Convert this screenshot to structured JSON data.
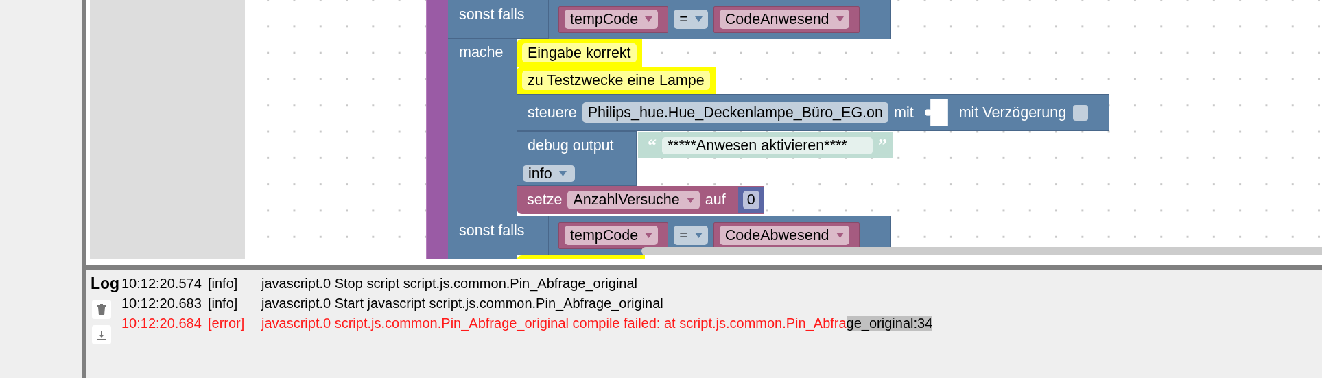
{
  "workspace": {
    "blocks": [
      {
        "kind": "else_if",
        "label": "sonst falls",
        "left_variable": "tempCode",
        "operator": "=",
        "right_variable": "CodeAnwesend"
      },
      {
        "kind": "do",
        "label": "mache"
      },
      {
        "kind": "comment",
        "text": "Eingabe korrekt"
      },
      {
        "kind": "comment",
        "text": "zu Testzwecke eine Lampe"
      },
      {
        "kind": "control",
        "label": "steuere",
        "object": "Philips_hue.Hue_Deckenlampe_Büro_EG.on",
        "with_label": "mit",
        "delay_label": "mit Verzögerung"
      },
      {
        "kind": "debug",
        "label": "debug output",
        "open_quote": "“",
        "text": "*****Anwesen aktivieren****",
        "close_quote": "”",
        "severity": "info"
      },
      {
        "kind": "set",
        "label": "setze",
        "variable": "AnzahlVersuche",
        "to_label": "auf",
        "value": "0"
      },
      {
        "kind": "else_if",
        "label": "sonst falls",
        "left_variable": "tempCode",
        "operator": "=",
        "right_variable": "CodeAbwesend"
      }
    ]
  },
  "log": {
    "title": "Log",
    "entries": [
      {
        "kind": "info",
        "time": "10:12:20.574",
        "severity": "[info]",
        "message": "javascript.0 Stop script script.js.common.Pin_Abfrage_original"
      },
      {
        "kind": "info",
        "time": "10:12:20.683",
        "severity": "[info]",
        "message": "javascript.0 Start javascript script.js.common.Pin_Abfrage_original"
      },
      {
        "kind": "error",
        "time": "10:12:20.684",
        "severity": "[error]",
        "message": "javascript.0 script.js.common.Pin_Abfrage_original compile failed: at script.js.common.Pin_Abfra",
        "highlighted": "ge_original:34"
      }
    ]
  }
}
